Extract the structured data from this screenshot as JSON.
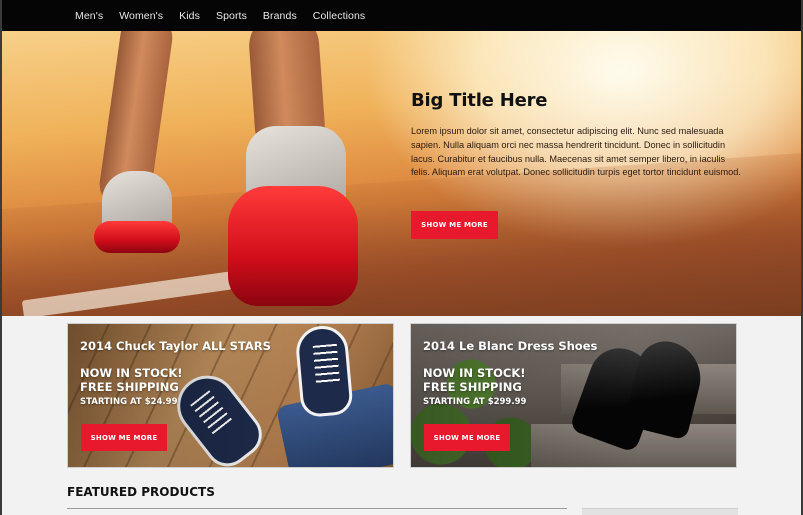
{
  "nav": {
    "items": [
      "Men's",
      "Women's",
      "Kids",
      "Sports",
      "Brands",
      "Collections"
    ]
  },
  "hero": {
    "title": "Big Title Here",
    "body": "Lorem ipsum dolor sit amet, consectetur adipiscing elit. Nunc sed malesuada sapien. Nulla aliquam orci nec massa hendrerit tincidunt. Donec in sollicitudin lacus. Curabitur et faucibus nulla. Maecenas sit amet semper libero, in iaculis felis. Aliquam erat volutpat. Donec sollicitudin turpis eget tortor tincidunt euismod.",
    "button_label": "SHOW ME MORE"
  },
  "promos": [
    {
      "title": "2014 Chuck Taylor ALL STARS",
      "stock_line1": "NOW IN STOCK!",
      "stock_line2": "FREE SHIPPING",
      "price": "STARTING AT $24.99",
      "button_label": "SHOW ME MORE"
    },
    {
      "title": "2014 Le Blanc Dress Shoes",
      "stock_line1": "NOW IN STOCK!",
      "stock_line2": "FREE SHIPPING",
      "price": "STARTING AT $299.99",
      "button_label": "SHOW ME MORE"
    }
  ],
  "featured": {
    "title": "FEATURED PRODUCTS"
  },
  "colors": {
    "nav_bg": "#050505",
    "accent": "#e8192c",
    "page_bg": "#f2f2f2"
  }
}
